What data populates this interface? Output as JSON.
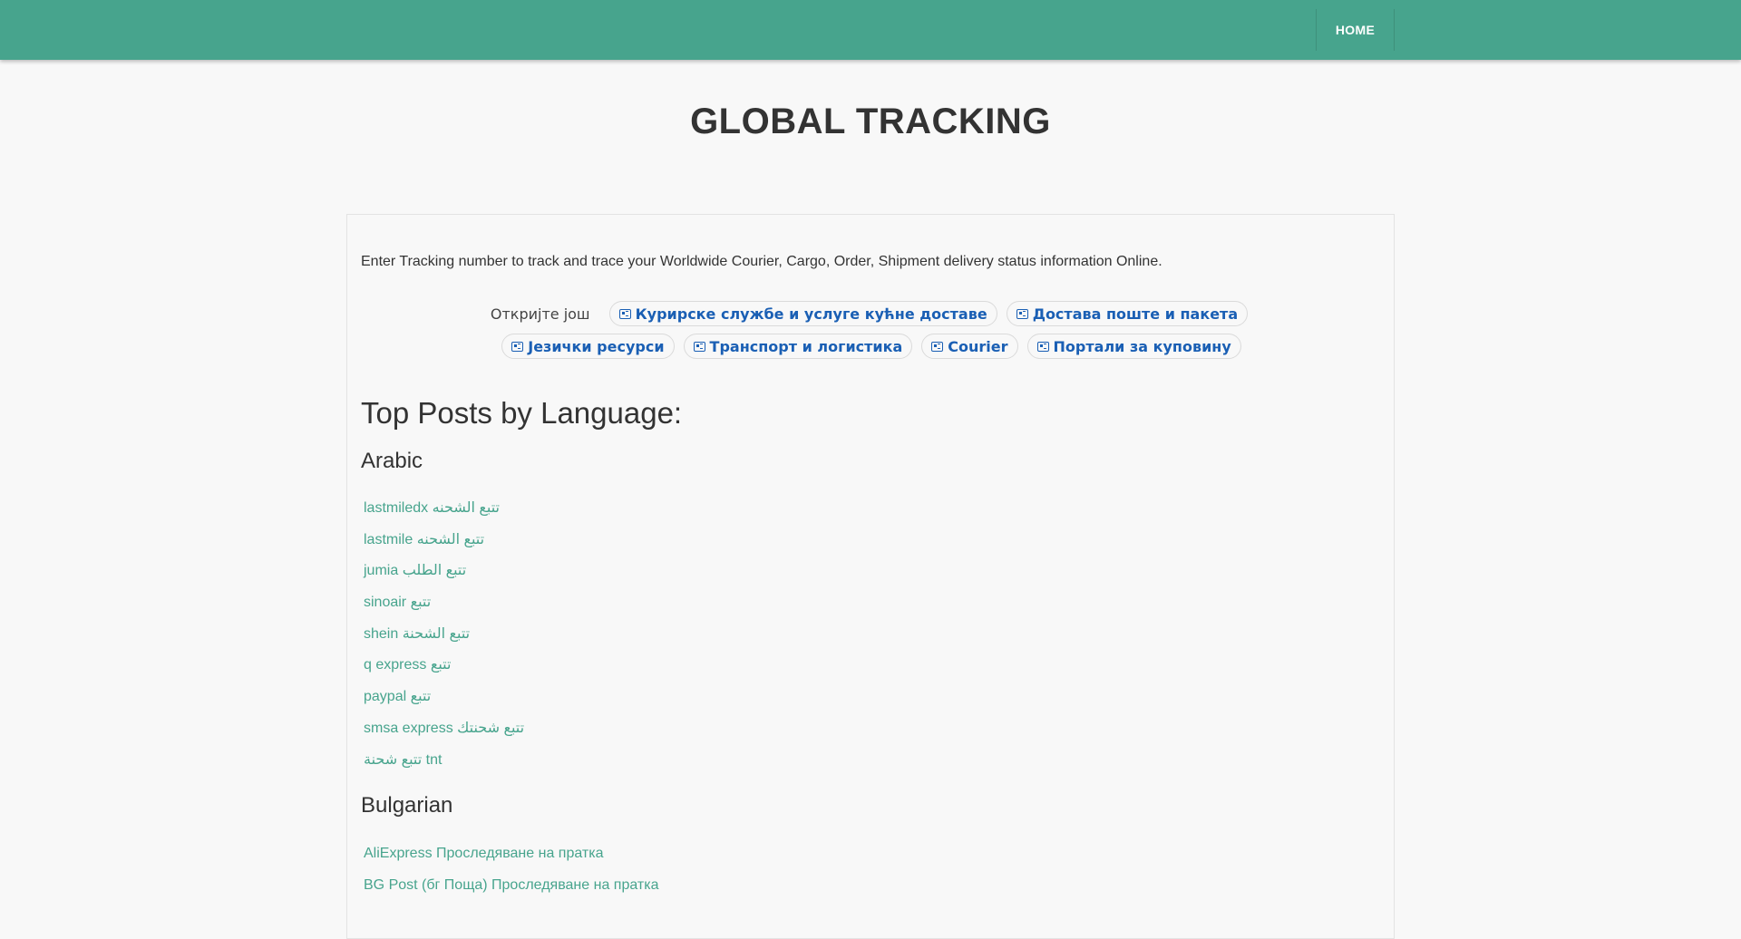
{
  "nav": {
    "home_label": "HOME"
  },
  "site": {
    "title": "GLOBAL TRACKING"
  },
  "intro": "Enter Tracking number to track and trace your Worldwide Courier, Cargo, Order, Shipment delivery status information Online.",
  "discover": {
    "label": "Откријте још",
    "chips": [
      "Курирске службе и услуге кућне доставе",
      "Достава поште и пакета",
      "Језички ресурси",
      "Транспорт и логистика",
      "Courier",
      "Портали за куповину"
    ]
  },
  "posts": {
    "heading": "Top Posts by Language:",
    "languages": [
      {
        "name": "Arabic",
        "items": [
          "lastmiledx تتبع الشحنه",
          "lastmile تتبع الشحنه",
          "jumia تتبع الطلب",
          "sinoair تتبع",
          "shein تتبع الشحنة",
          "q express تتبع",
          "paypal تتبع",
          "smsa express تتبع شحنتك",
          "تتبع شحنة tnt"
        ]
      },
      {
        "name": "Bulgarian",
        "items": [
          "AliExpress Проследяване на пратка",
          "BG Post (бг Поща) Проследяване на пратка"
        ]
      }
    ]
  },
  "colors": {
    "navbar": "#47a48d",
    "link": "#47a48d",
    "chip_text": "#1a5fb4"
  },
  "icons": {
    "chip": "news-card-icon"
  }
}
